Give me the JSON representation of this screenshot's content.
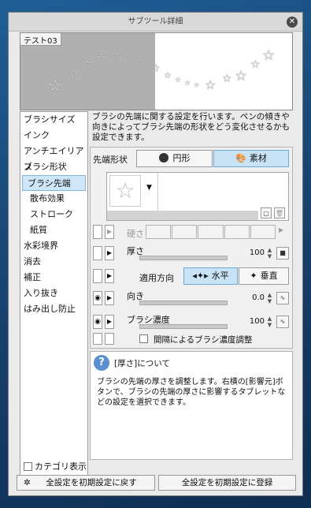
{
  "window": {
    "title": "サブツール詳細"
  },
  "preview": {
    "label": "テスト03"
  },
  "categories": [
    {
      "label": "ブラシサイズ"
    },
    {
      "label": "インク"
    },
    {
      "label": "アンチエイリアス"
    },
    {
      "label": "ブラシ形状"
    },
    {
      "label": "ブラシ先端"
    },
    {
      "label": "散布効果"
    },
    {
      "label": "ストローク"
    },
    {
      "label": "紙質"
    },
    {
      "label": "水彩境界"
    },
    {
      "label": "消去"
    },
    {
      "label": "補正"
    },
    {
      "label": "入り抜き"
    },
    {
      "label": "はみ出し防止"
    }
  ],
  "category_footer": {
    "label": "カテゴリ表示"
  },
  "description": "ブラシの先端に関する設定を行います。ペンの傾きや向きによってブラシ先端の形状をどう変化させるかも設定できます。",
  "tip_shape": {
    "label": "先端形状",
    "option_circle": "円形",
    "option_material": "素材",
    "selected": "素材"
  },
  "hardness": {
    "label": "硬さ"
  },
  "thickness": {
    "label": "厚さ",
    "value": "100"
  },
  "direction_apply": {
    "label": "適用方向",
    "option_h": "水平",
    "option_v": "垂直",
    "selected": "水平"
  },
  "orientation": {
    "label": "向き",
    "value": "0.0"
  },
  "brush_density": {
    "label": "ブラシ濃度",
    "value": "100"
  },
  "interval_density": {
    "label": "間隔によるブラシ濃度調整"
  },
  "tip": {
    "title": "[厚さ]について",
    "body": "ブラシの先端の厚さを調整します。右横の[影響元]ボタンで、ブラシの先端の厚さに影響するタブレットなどの設定を選択できます。"
  },
  "buttons": {
    "reset": "全設定を初期設定に戻す",
    "register": "全設定を初期設定に登録"
  }
}
